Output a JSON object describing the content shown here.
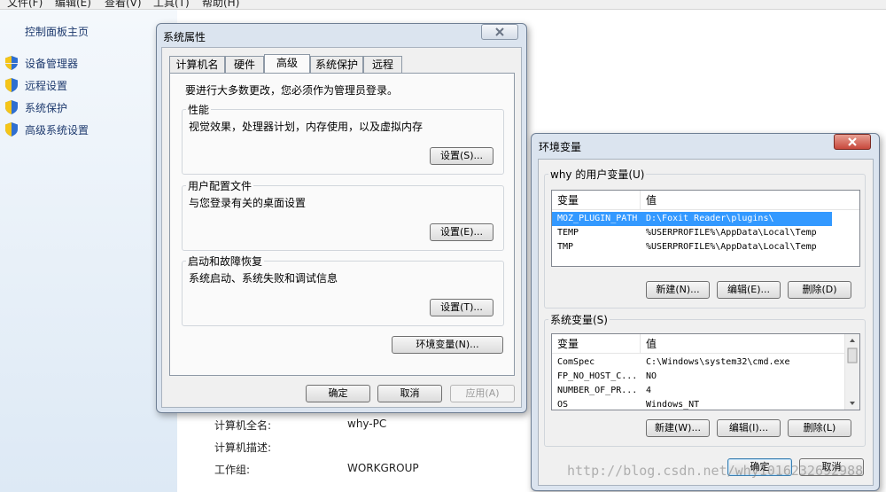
{
  "menubar": {
    "items": [
      "文件(F)",
      "编辑(E)",
      "查看(V)",
      "工具(T)",
      "帮助(H)"
    ]
  },
  "leftnav": {
    "home": "控制面板主页",
    "items": [
      "设备管理器",
      "远程设置",
      "系统保护",
      "高级系统设置"
    ]
  },
  "background": {
    "full_name_label": "计算机全名:",
    "full_name_value": "why-PC",
    "desc_label": "计算机描述:",
    "workgroup_label": "工作组:",
    "workgroup_value": "WORKGROUP"
  },
  "sysprops": {
    "title": "系统属性",
    "tabs": [
      "计算机名",
      "硬件",
      "高级",
      "系统保护",
      "远程"
    ],
    "admin_note": "要进行大多数更改，您必须作为管理员登录。",
    "performance": {
      "label": "性能",
      "desc": "视觉效果，处理器计划，内存使用，以及虚拟内存",
      "button": "设置(S)..."
    },
    "profiles": {
      "label": "用户配置文件",
      "desc": "与您登录有关的桌面设置",
      "button": "设置(E)..."
    },
    "startup": {
      "label": "启动和故障恢复",
      "desc": "系统启动、系统失败和调试信息",
      "button": "设置(T)..."
    },
    "env_button": "环境变量(N)...",
    "ok": "确定",
    "cancel": "取消",
    "apply": "应用(A)"
  },
  "envvars": {
    "title": "环境变量",
    "user_label": "why 的用户变量(U)",
    "col_var": "变量",
    "col_val": "值",
    "user_rows": [
      {
        "name": "MOZ_PLUGIN_PATH",
        "value": "D:\\Foxit Reader\\plugins\\"
      },
      {
        "name": "TEMP",
        "value": "%USERPROFILE%\\AppData\\Local\\Temp"
      },
      {
        "name": "TMP",
        "value": "%USERPROFILE%\\AppData\\Local\\Temp"
      }
    ],
    "user_buttons": {
      "new": "新建(N)...",
      "edit": "编辑(E)...",
      "delete": "删除(D)"
    },
    "system_label": "系统变量(S)",
    "system_rows": [
      {
        "name": "ComSpec",
        "value": "C:\\Windows\\system32\\cmd.exe"
      },
      {
        "name": "FP_NO_HOST_C...",
        "value": "NO"
      },
      {
        "name": "NUMBER_OF_PR...",
        "value": "4"
      },
      {
        "name": "OS",
        "value": "Windows_NT"
      }
    ],
    "system_buttons": {
      "new": "新建(W)...",
      "edit": "编辑(I)...",
      "delete": "删除(L)"
    },
    "ok": "确定",
    "cancel": "取消"
  },
  "watermark": "http://blog.csdn.net/why1016232692988",
  "colors": {
    "selection": "#3399ff",
    "close_red": "#c8483c",
    "nav_link": "#1e3a6e"
  }
}
